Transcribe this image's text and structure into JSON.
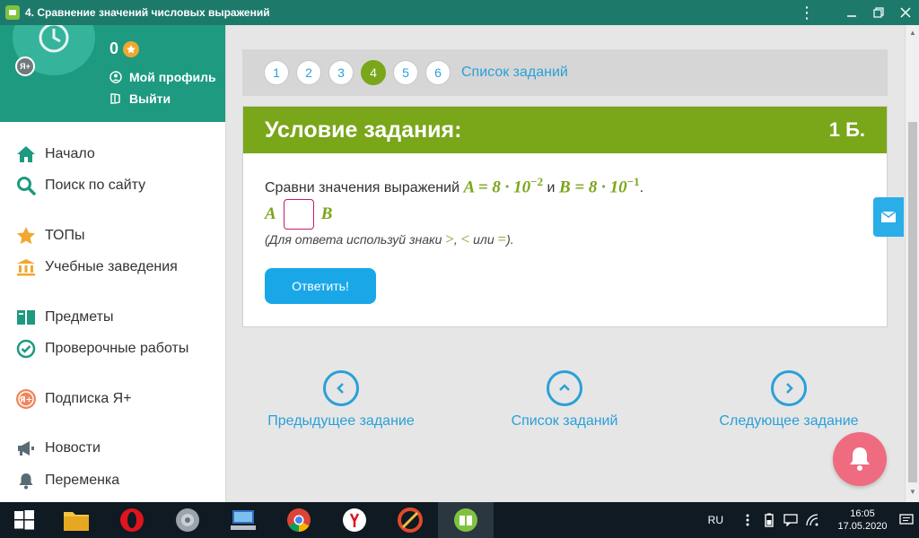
{
  "window": {
    "title": "4. Сравнение значений числовых выражений"
  },
  "profile": {
    "points": "0",
    "badge": "Я+",
    "my_profile": "Мой профиль",
    "logout": "Выйти"
  },
  "nav": {
    "home": "Начало",
    "search": "Поиск по сайту",
    "tops": "ТОПы",
    "schools": "Учебные заведения",
    "subjects": "Предметы",
    "tests": "Проверочные работы",
    "subscription": "Подписка Я+",
    "news": "Новости",
    "break": "Переменка"
  },
  "task_nav": {
    "numbers": [
      "1",
      "2",
      "3",
      "4",
      "5",
      "6"
    ],
    "active": "4",
    "list_link": "Список заданий"
  },
  "task": {
    "header": "Условие задания:",
    "points": "1 Б.",
    "question_prefix": "Сравни значения выражений",
    "expr_a": "A = 8 · 10",
    "exp_a": "−2",
    "conj": "и",
    "expr_b": "B = 8 · 10",
    "exp_b": "−1",
    "period": ".",
    "left_var": "A",
    "right_var": "B",
    "hint_prefix": "(Для ответа используй знаки",
    "sym_gt": ">",
    "comma": ",",
    "sym_lt": "<",
    "hint_or": "или",
    "sym_eq": "=",
    "hint_suffix": ").",
    "submit": "Ответить!"
  },
  "bottom_nav": {
    "prev": "Предыдущее задание",
    "list": "Список заданий",
    "next": "Следующее задание"
  },
  "tray": {
    "lang": "RU",
    "time": "16:05",
    "date": "17.05.2020"
  },
  "colors": {
    "teal": "#1d9a80",
    "green": "#7aa61a",
    "blue": "#2aa0d8",
    "pink": "#ee6b80"
  }
}
